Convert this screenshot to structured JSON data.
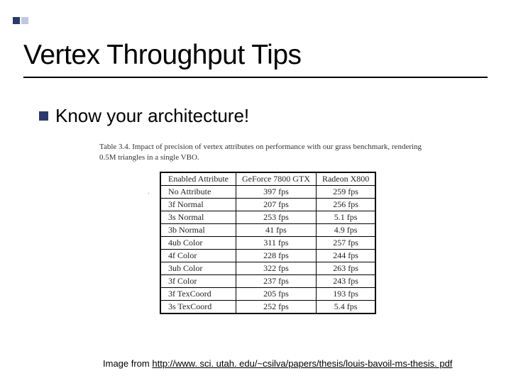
{
  "slide": {
    "title": "Vertex Throughput Tips",
    "bullet": "Know your architecture!",
    "caption": "Table 3.4. Impact of precision of vertex attributes on performance with our grass benchmark, rendering 0.5M triangles in a single VBO.",
    "credit_prefix": "Image from ",
    "credit_link": "http://www. sci. utah. edu/~csilva/papers/thesis/louis-bavoil-ms-thesis. pdf"
  },
  "table": {
    "headers": [
      "Enabled Attribute",
      "GeForce 7800 GTX",
      "Radeon X800"
    ],
    "rows": [
      [
        "No Attribute",
        "397 fps",
        "259 fps"
      ],
      [
        "3f Normal",
        "207 fps",
        "256 fps"
      ],
      [
        "3s Normal",
        "253 fps",
        "5.1 fps"
      ],
      [
        "3b Normal",
        "41 fps",
        "4.9 fps"
      ],
      [
        "4ub Color",
        "311 fps",
        "257 fps"
      ],
      [
        "4f Color",
        "228 fps",
        "244 fps"
      ],
      [
        "3ub Color",
        "322 fps",
        "263 fps"
      ],
      [
        "3f Color",
        "237 fps",
        "243 fps"
      ],
      [
        "3f TexCoord",
        "205 fps",
        "193 fps"
      ],
      [
        "3s TexCoord",
        "252 fps",
        "5.4 fps"
      ]
    ]
  },
  "chart_data": {
    "type": "table",
    "title": "Impact of precision of vertex attributes on performance (grass benchmark, 0.5M triangles, single VBO)",
    "columns": [
      "Enabled Attribute",
      "GeForce 7800 GTX (fps)",
      "Radeon X800 (fps)"
    ],
    "rows": [
      {
        "attribute": "No Attribute",
        "geforce_7800_gtx": 397,
        "radeon_x800": 259
      },
      {
        "attribute": "3f Normal",
        "geforce_7800_gtx": 207,
        "radeon_x800": 256
      },
      {
        "attribute": "3s Normal",
        "geforce_7800_gtx": 253,
        "radeon_x800": 5.1
      },
      {
        "attribute": "3b Normal",
        "geforce_7800_gtx": 41,
        "radeon_x800": 4.9
      },
      {
        "attribute": "4ub Color",
        "geforce_7800_gtx": 311,
        "radeon_x800": 257
      },
      {
        "attribute": "4f Color",
        "geforce_7800_gtx": 228,
        "radeon_x800": 244
      },
      {
        "attribute": "3ub Color",
        "geforce_7800_gtx": 322,
        "radeon_x800": 263
      },
      {
        "attribute": "3f Color",
        "geforce_7800_gtx": 237,
        "radeon_x800": 243
      },
      {
        "attribute": "3f TexCoord",
        "geforce_7800_gtx": 205,
        "radeon_x800": 193
      },
      {
        "attribute": "3s TexCoord",
        "geforce_7800_gtx": 252,
        "radeon_x800": 5.4
      }
    ]
  }
}
